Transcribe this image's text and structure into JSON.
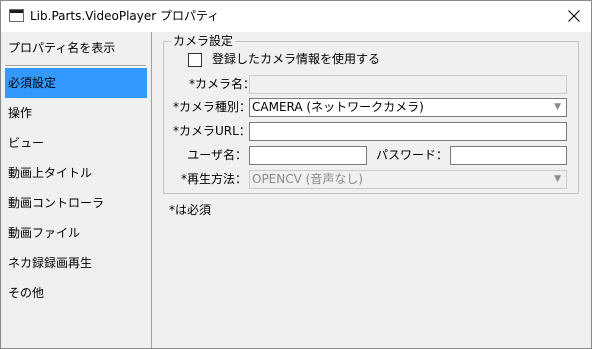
{
  "window": {
    "title": "Lib.Parts.VideoPlayer プロパティ",
    "close_icon": "close-icon"
  },
  "sidebar": {
    "header": "プロパティ名を表示",
    "items": [
      {
        "label": "必須設定",
        "selected": true
      },
      {
        "label": "操作",
        "selected": false
      },
      {
        "label": "ビュー",
        "selected": false
      },
      {
        "label": "動画上タイトル",
        "selected": false
      },
      {
        "label": "動画コントローラ",
        "selected": false
      },
      {
        "label": "動画ファイル",
        "selected": false
      },
      {
        "label": "ネカ録録画再生",
        "selected": false
      },
      {
        "label": "その他",
        "selected": false
      }
    ],
    "selected_color": "#3399ff"
  },
  "camera_group": {
    "title": "カメラ設定",
    "use_registered_label": "登録したカメラ情報を使用する",
    "use_registered_checked": false,
    "camera_name_label": "*カメラ名：",
    "camera_name_value": "",
    "camera_type_label": "*カメラ種別：",
    "camera_type_value": "CAMERA (ネットワークカメラ)",
    "camera_url_label": "*カメラURL：",
    "camera_url_value": "",
    "username_label": "ユーザ名：",
    "username_value": "",
    "password_label": "パスワード：",
    "password_value": "",
    "playback_label": "*再生方法：",
    "playback_value": "OPENCV (音声なし)"
  },
  "note": "*は必須",
  "dropdown_arrow": "▼"
}
